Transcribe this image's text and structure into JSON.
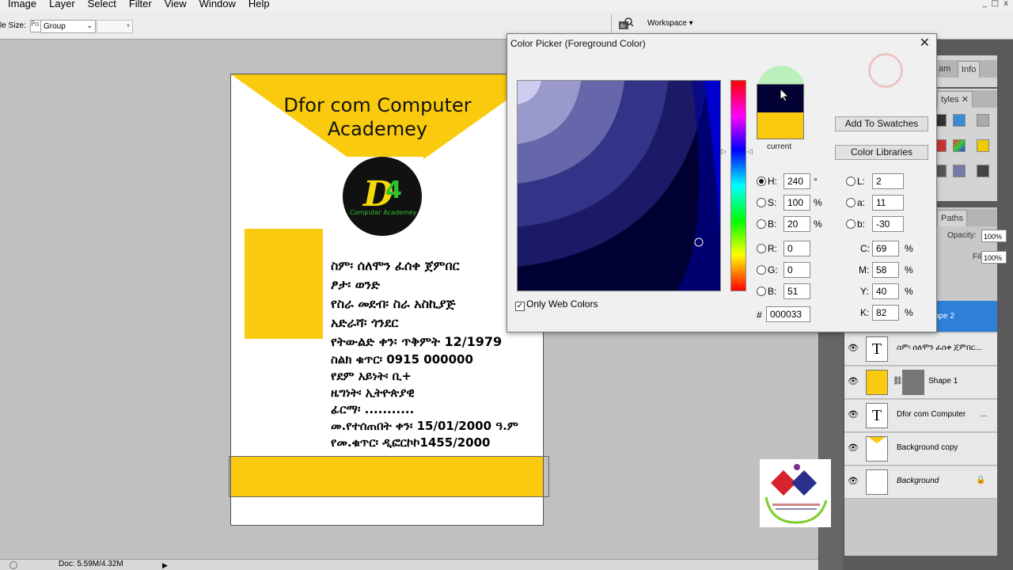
{
  "menubar": {
    "items": [
      "Image",
      "Layer",
      "Select",
      "Filter",
      "View",
      "Window",
      "Help"
    ],
    "window_buttons": [
      "_",
      "□",
      "x"
    ]
  },
  "options_bar": {
    "label": "le Size:",
    "field_prefix": "Po",
    "select_value": "Group",
    "workspace": "Workspace ▾"
  },
  "document": {
    "title_line1": "Dfor com Computer",
    "title_line2": "Academey",
    "logo_text": "Computer Academey",
    "logo_letter": "D",
    "logo_digit": "4",
    "info_lines": [
      "ስም፡ ሰለሞን ፈሰቀ ጀምበር",
      "ፆታ፡ ወንድ",
      "የስራ መደብ፡ ስራ አስኪያጅ",
      "አድራሻ፡ ጎንደር",
      "የትውልድ ቀን፡ ጥቅምት 12/1979",
      "ስልክ ቁጥር፡ 0915 000000",
      "የደም አይነት፡ ቢ+",
      "ዜግነት፡ ኢትዮጵያዊ",
      "ፊርማ፡ ...........",
      "መ.የተሰጠበት ቀን፡ 15/01/2000 ዓ.ም",
      "የመ.ቁጥር፡ ዲፎርኮኮ1455/2000"
    ],
    "colors": {
      "yellow": "#f9ca0e"
    }
  },
  "status_bar": {
    "doc_info": "Doc: 5.59M/4.32M",
    "nav": "▶"
  },
  "color_picker": {
    "title": "Color Picker (Foreground Color)",
    "close": "✕",
    "current_label": "current",
    "add_to_swatches": "Add To Swatches",
    "color_libraries": "Color Libraries",
    "only_web_colors": "Only Web Colors",
    "only_web_checked": true,
    "new_color": "#000033",
    "current_color": "#f9ca0e",
    "hsb": [
      {
        "label": "H:",
        "value": "240",
        "unit": "°",
        "selected": true
      },
      {
        "label": "S:",
        "value": "100",
        "unit": "%",
        "selected": false
      },
      {
        "label": "B:",
        "value": "20",
        "unit": "%",
        "selected": false
      }
    ],
    "rgb": [
      {
        "label": "R:",
        "value": "0"
      },
      {
        "label": "G:",
        "value": "0"
      },
      {
        "label": "B:",
        "value": "51"
      }
    ],
    "lab": [
      {
        "label": "L:",
        "value": "2"
      },
      {
        "label": "a:",
        "value": "11"
      },
      {
        "label": "b:",
        "value": "-30"
      }
    ],
    "cmyk": [
      {
        "label": "C:",
        "value": "69",
        "unit": "%"
      },
      {
        "label": "M:",
        "value": "58",
        "unit": "%"
      },
      {
        "label": "Y:",
        "value": "40",
        "unit": "%"
      },
      {
        "label": "K:",
        "value": "82",
        "unit": "%"
      }
    ],
    "hex_label": "#",
    "hex_value": "000033"
  },
  "panels": {
    "tabs_top": [
      "am",
      "Info"
    ],
    "styles_tab": "tyles",
    "paths_tab": "Paths",
    "opacity_label": "Opacity:",
    "opacity_value": "100%",
    "fill_label": "Fill:",
    "fill_value": "100%",
    "layers": [
      {
        "name": "ape 2",
        "type": "selected"
      },
      {
        "name": "ስም፡ ሰለሞን ፈሰቀ ጀምበር...",
        "type": "text"
      },
      {
        "name": "Shape 1",
        "type": "shape"
      },
      {
        "name": "Dfor com Computer",
        "type": "text",
        "suffix": "..."
      },
      {
        "name": "Background copy",
        "type": "image"
      },
      {
        "name": "Background",
        "type": "background"
      }
    ]
  }
}
